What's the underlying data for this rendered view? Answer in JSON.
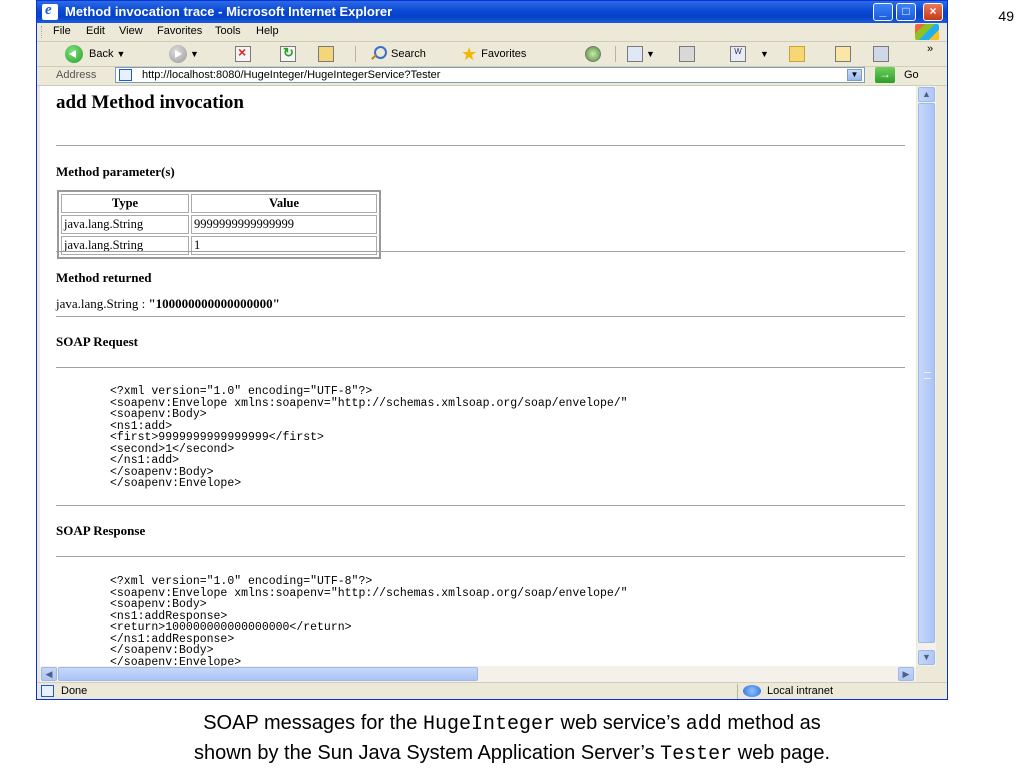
{
  "slide_number": "49",
  "window": {
    "title": "Method invocation trace - Microsoft Internet Explorer",
    "controls": {
      "minimize": "_",
      "maximize": "□",
      "close": "×"
    }
  },
  "menu": [
    "File",
    "Edit",
    "View",
    "Favorites",
    "Tools",
    "Help"
  ],
  "toolbar": {
    "back_label": "Back",
    "search_label": "Search",
    "favorites_label": "Favorites",
    "chevron": "»"
  },
  "address_bar": {
    "label": "Address",
    "url": "http://localhost:8080/HugeInteger/HugeIntegerService?Tester",
    "go_label": "Go"
  },
  "page": {
    "heading": "add Method invocation",
    "params_heading": "Method parameter(s)",
    "params_table": {
      "headers": [
        "Type",
        "Value"
      ],
      "rows": [
        [
          "java.lang.String",
          "9999999999999999"
        ],
        [
          "java.lang.String",
          "1"
        ]
      ]
    },
    "returned_heading": "Method returned",
    "returned_type": "java.lang.String : ",
    "returned_value": "\"100000000000000000\"",
    "soap_request_heading": "SOAP Request",
    "soap_request": [
      "<?xml version=\"1.0\" encoding=\"UTF-8\"?>",
      "<soapenv:Envelope xmlns:soapenv=\"http://schemas.xmlsoap.org/soap/envelope/\"",
      "<soapenv:Body>",
      "<ns1:add>",
      "<first>9999999999999999</first>",
      "<second>1</second>",
      "</ns1:add>",
      "</soapenv:Body>",
      "</soapenv:Envelope>"
    ],
    "soap_response_heading": "SOAP Response",
    "soap_response": [
      "<?xml version=\"1.0\" encoding=\"UTF-8\"?>",
      "<soapenv:Envelope xmlns:soapenv=\"http://schemas.xmlsoap.org/soap/envelope/\"",
      "<soapenv:Body>",
      "<ns1:addResponse>",
      "<return>100000000000000000</return>",
      "</ns1:addResponse>",
      "</soapenv:Body>",
      "</soapenv:Envelope>"
    ]
  },
  "status_bar": {
    "status": "Done",
    "zone": "Local intranet"
  },
  "caption": {
    "part1": "SOAP messages for the ",
    "code1": "HugeInteger",
    "part2": " web service’s ",
    "code2": "add",
    "part3": " method as",
    "part4": "shown by the Sun Java System Application Server’s ",
    "code3": "Tester",
    "part5": " web page."
  },
  "colors": {
    "titlebar": "#0a48d2",
    "chrome": "#ece9d8",
    "scrollbar": "#b0c7f3"
  }
}
